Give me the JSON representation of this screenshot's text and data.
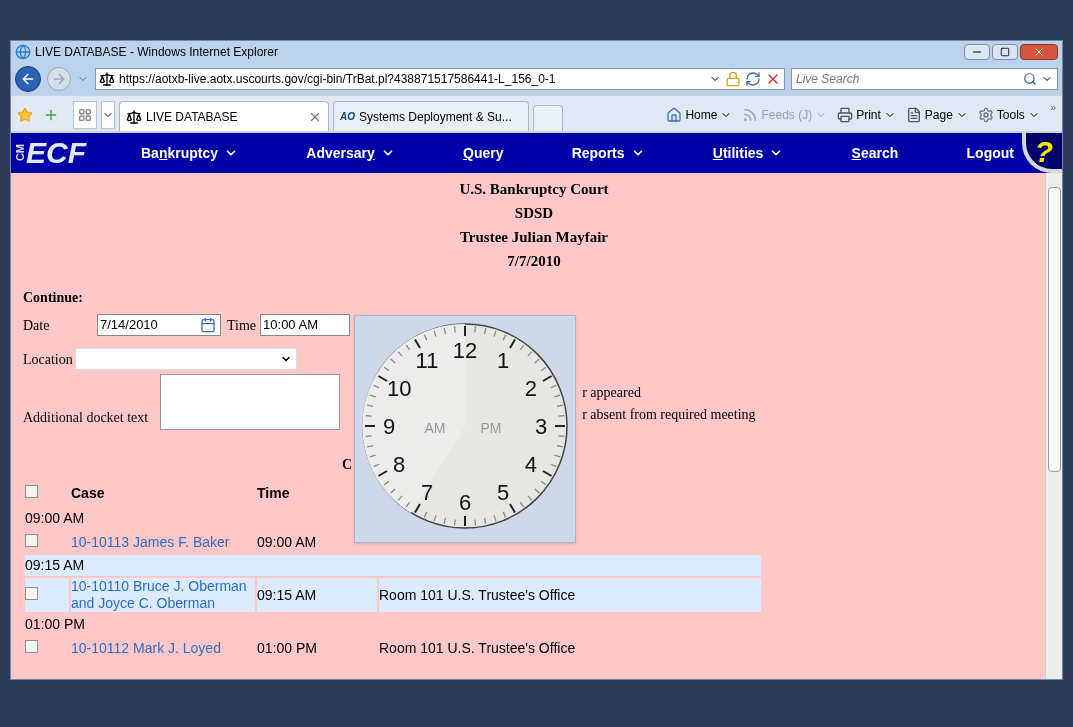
{
  "browser": {
    "title": "LIVE DATABASE - Windows Internet Explorer",
    "url": "https://aotxb-live.aotx.uscourts.gov/cgi-bin/TrBat.pl?438871517586441-L_156_0-1",
    "search_placeholder": "Live Search",
    "tabs": [
      {
        "label": "LIVE DATABASE",
        "selected": true,
        "kind": "scale"
      },
      {
        "label": "Systems Deployment & Su...",
        "selected": false,
        "kind": "ao"
      }
    ],
    "ao_logo": "AO",
    "commands": [
      {
        "label": "Home",
        "kind": "home",
        "disabled": false
      },
      {
        "label": "Feeds (J)",
        "kind": "feeds",
        "disabled": true
      },
      {
        "label": "Print",
        "kind": "print",
        "disabled": false
      },
      {
        "label": "Page",
        "kind": "page",
        "disabled": false
      },
      {
        "label": "Tools",
        "kind": "tools",
        "disabled": false
      }
    ],
    "more": "»"
  },
  "app": {
    "logo_small": "CM",
    "logo_large": "ECF",
    "help": "?",
    "nav": [
      {
        "before": "Ba",
        "key": "n",
        "after": "kruptcy",
        "dropdown": true
      },
      {
        "before": "Adversar",
        "key": "y",
        "dropdown": true
      },
      {
        "key": "Q",
        "after": "uery",
        "dropdown": false
      },
      {
        "before": "Reports",
        "dropdown": true
      },
      {
        "key": "U",
        "after": "tilities",
        "dropdown": true
      },
      {
        "key": "S",
        "after": "earch",
        "dropdown": false
      },
      {
        "before": "Logout",
        "dropdown": false
      }
    ]
  },
  "header": [
    "U.S. Bankruptcy Court",
    "SDSD",
    "Trustee Julian Mayfair",
    "7/7/2010"
  ],
  "form": {
    "continue_label": "Continue:",
    "date_label": "Date",
    "date_value": "7/14/2010",
    "time_label": "Time",
    "time_value": "10:00 AM",
    "location_label": "Location",
    "docket_label": "Additional docket text",
    "options": [
      "r appeared",
      "r absent from required meeting"
    ],
    "section_heading": "C"
  },
  "table": {
    "all_checked": false,
    "columns": [
      "Case",
      "Time"
    ],
    "groups": [
      {
        "time": "09:00 AM",
        "shaded": false,
        "rows": [
          {
            "case": "10-10113 James F. Baker",
            "time": "09:00 AM",
            "checked": false
          }
        ]
      },
      {
        "time": "09:15 AM",
        "shaded": true,
        "rows": [
          {
            "case": "10-10110 Bruce J. Oberman and Joyce C. Oberman",
            "time": "09:15 AM",
            "location": "Room 101 U.S. Trustee's Office",
            "checked": false
          }
        ]
      },
      {
        "time": "01:00 PM",
        "shaded": false,
        "rows": [
          {
            "case": "10-10112 Mark J. Loyed",
            "time": "01:00 PM",
            "location": "Room 101 U.S. Trustee's Office",
            "checked": false
          }
        ]
      }
    ]
  },
  "clock": {
    "numbers": [
      "11",
      "12",
      "1",
      "10",
      "2",
      "9",
      "3",
      "8",
      "4",
      "7",
      "6",
      "5"
    ],
    "am": "AM",
    "pm": "PM"
  }
}
